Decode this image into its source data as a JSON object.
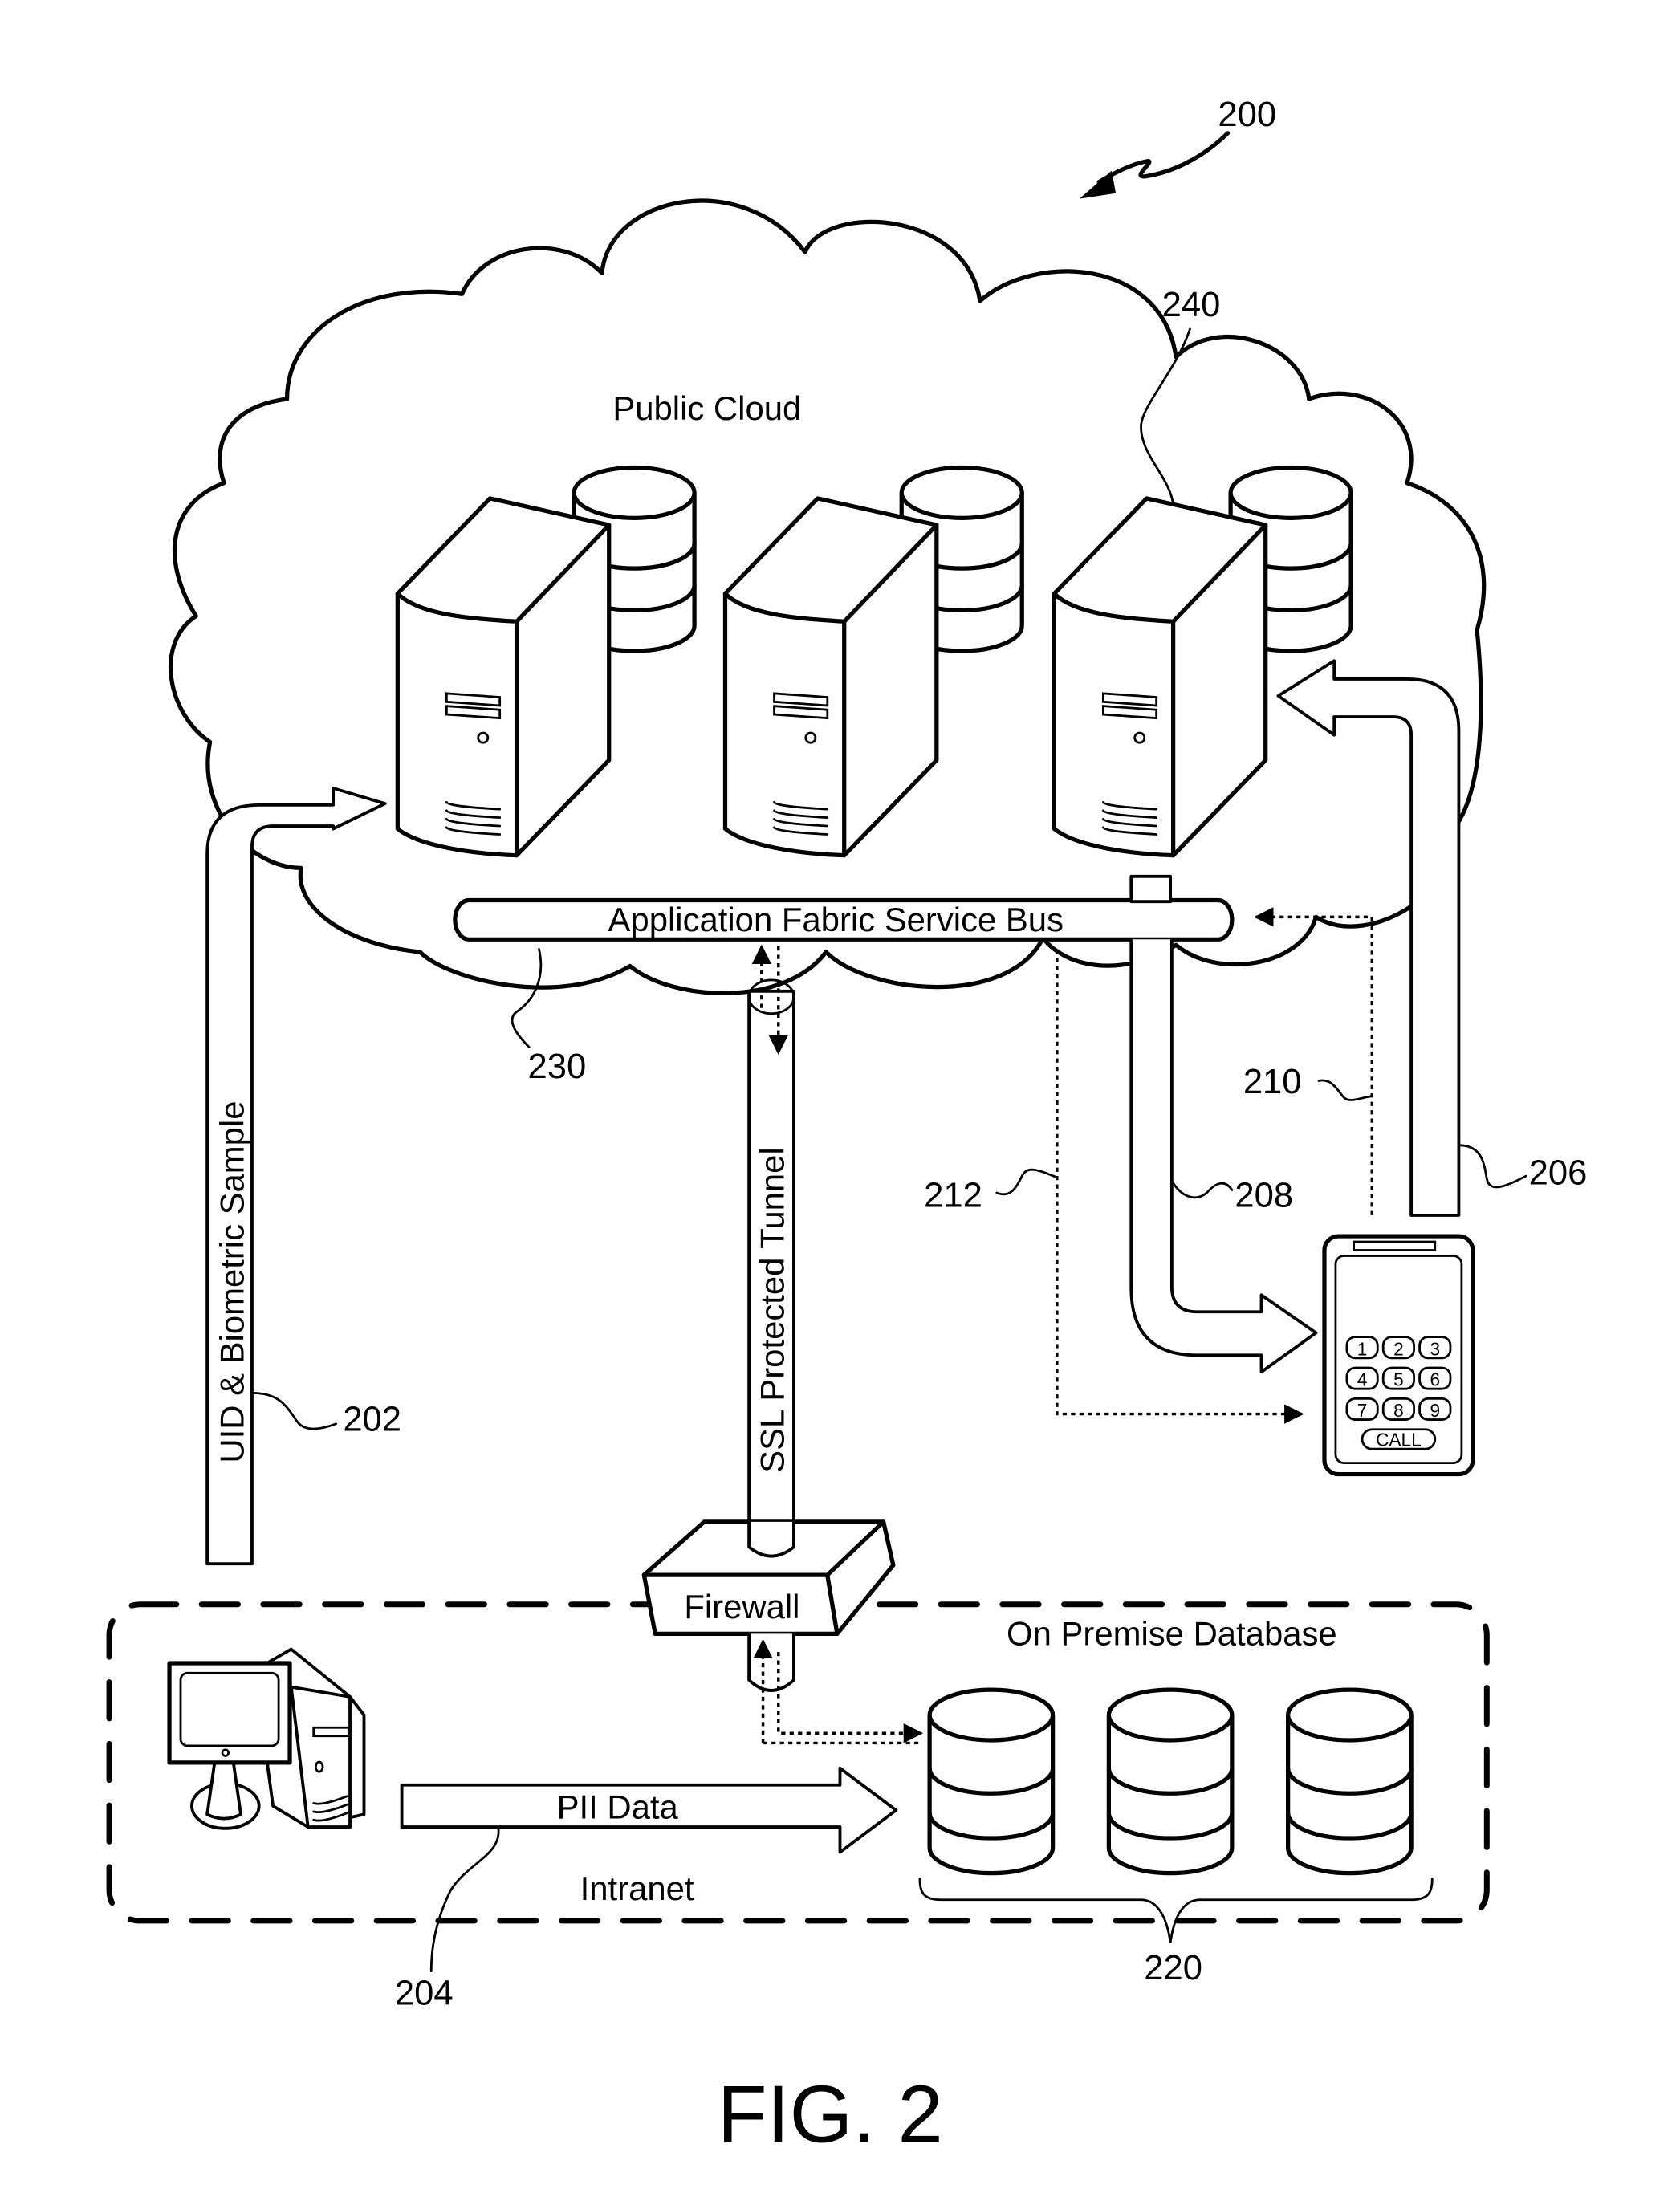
{
  "figure": {
    "caption": "FIG. 2",
    "reference_number": "200"
  },
  "public_cloud": {
    "label": "Public Cloud",
    "reference_number": "240",
    "servers": [
      {
        "name": "server-1",
        "has_database": true
      },
      {
        "name": "server-2",
        "has_database": true
      },
      {
        "name": "server-3",
        "has_database": true
      }
    ]
  },
  "service_bus": {
    "label": "Application Fabric Service Bus",
    "reference_number": "230"
  },
  "tunnel": {
    "label": "SSL Protected Tunnel"
  },
  "firewall": {
    "label": "Firewall"
  },
  "intranet": {
    "label": "Intranet",
    "database_label": "On Premise Database",
    "database_reference_number": "220",
    "database_count": 3
  },
  "flows": {
    "uid_biometric": {
      "label": "UID & Biometric Sample",
      "reference_number": "202"
    },
    "pii_data": {
      "label": "PII Data",
      "reference_number": "204"
    },
    "device_to_server": {
      "reference_number": "206"
    },
    "server_to_device": {
      "reference_number": "208"
    },
    "device_to_bus": {
      "reference_number": "210"
    },
    "bus_to_device": {
      "reference_number": "212"
    }
  },
  "mobile_device": {
    "keys": [
      "1",
      "2",
      "3",
      "4",
      "5",
      "6",
      "7",
      "8",
      "9"
    ],
    "call_label": "CALL"
  }
}
